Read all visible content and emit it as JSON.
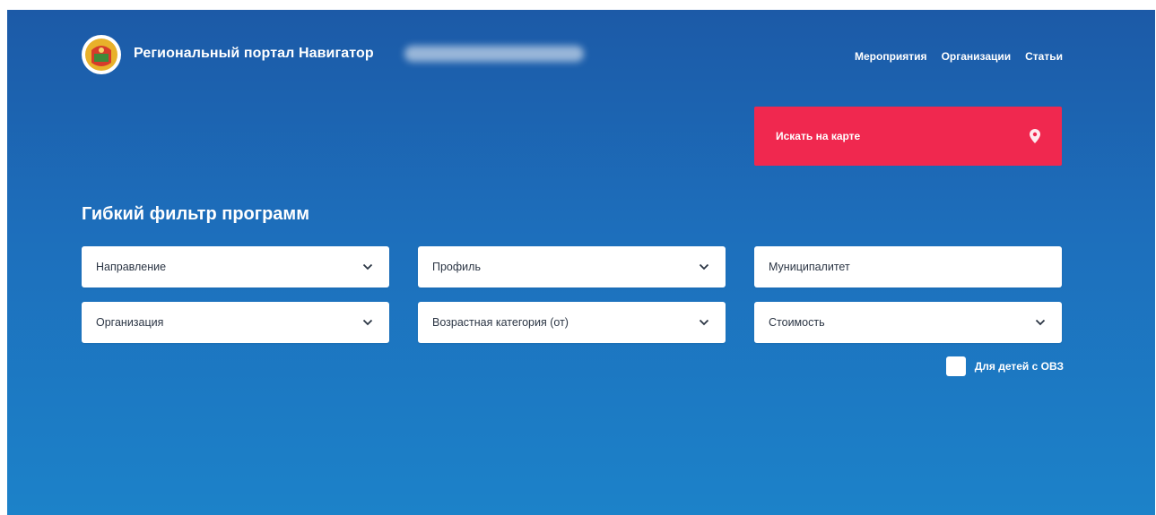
{
  "header": {
    "site_title": "Региональный портал Навигатор",
    "nav": [
      {
        "label": "Мероприятия"
      },
      {
        "label": "Организации"
      },
      {
        "label": "Статьи"
      }
    ]
  },
  "map_button": {
    "label": "Искать на карте",
    "icon": "map-pin-icon"
  },
  "filter": {
    "title": "Гибкий фильтр программ",
    "fields": [
      {
        "label": "Направление",
        "has_dropdown": true
      },
      {
        "label": "Профиль",
        "has_dropdown": true
      },
      {
        "label": "Муниципалитет",
        "has_dropdown": false
      },
      {
        "label": "Организация",
        "has_dropdown": true
      },
      {
        "label": "Возрастная категория (от)",
        "has_dropdown": true
      },
      {
        "label": "Стоимость",
        "has_dropdown": true
      }
    ],
    "checkbox_label": "Для детей с ОВЗ"
  },
  "colors": {
    "background_top": "#1c5aa7",
    "background_bottom": "#1c82c9",
    "accent_button": "#f0284f",
    "field_text": "#2b3544"
  }
}
